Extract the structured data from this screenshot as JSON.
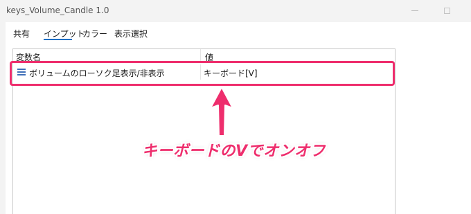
{
  "window": {
    "title": "keys_Volume_Candle 1.0"
  },
  "tabs": [
    {
      "label": "共有"
    },
    {
      "label": "インプット",
      "selected": true
    },
    {
      "label": "カラー"
    },
    {
      "label": "表示選択"
    }
  ],
  "table": {
    "columns": [
      "変数名",
      "値"
    ],
    "rows": [
      {
        "name": "ボリュームのローソク足表示/非表示",
        "value": "キーボード[V]"
      }
    ]
  },
  "annotation": {
    "text": "キーボードのVでオンオフ",
    "color": "#ee2e6d"
  },
  "colors": {
    "accent_tab": "#1f6fc4",
    "highlight": "#ee2e6d"
  }
}
